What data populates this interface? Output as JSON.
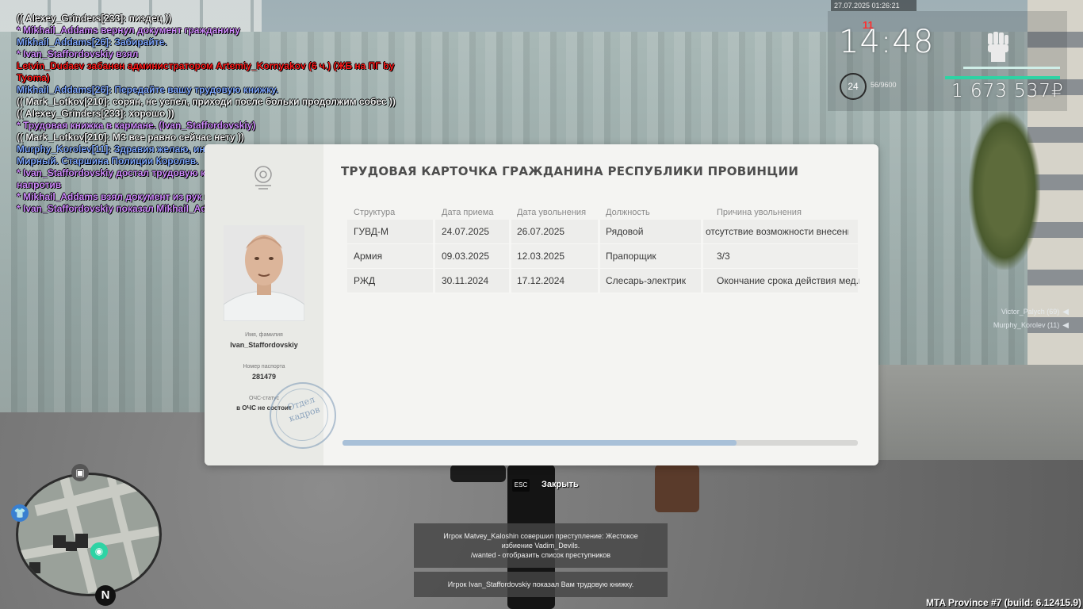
{
  "chat": [
    {
      "text": "(( Alexey_Grinders[233]: пиздец ))",
      "color": "white"
    },
    {
      "text": "* Mikhail_Addams вернул документ гражданину",
      "color": "purple"
    },
    {
      "text": "Mikhail_Addams[26]: Забирайте.",
      "color": "blue"
    },
    {
      "text": "* Ivan_Staffordovskiy взял",
      "color": "purple"
    },
    {
      "text": "Letvin_Dudaev забанен администратором Artemiy_Kornyakov (6 ч.) (ЖБ на ПГ by Tyoma)",
      "color": "red"
    },
    {
      "text": "Mikhail_Addams[26]: Передайте вашу трудовую книжку.",
      "color": "blue"
    },
    {
      "text": "(( Mark_Lotkov[210]: сорян, не успел, приходи после больки продолжим собес ))",
      "color": "white"
    },
    {
      "text": "(( Alexey_Grinders[233]: хорошо ))",
      "color": "white"
    },
    {
      "text": "* Трудовая книжка в кармане. (Ivan_Staffordovskiy)",
      "color": "purple"
    },
    {
      "text": "(( Mark_Lotkov[210]: МЗ все равно сейчас нету ))",
      "color": "white"
    },
    {
      "text": "Murphy_Korolev[11]: Здравия желаю, инспектор ОБ ДПС ГИБДД по городу Мирный. Старшина Полиции Королев.",
      "color": "blue"
    },
    {
      "text": "* Ivan_Staffordovskiy достал трудовую книжку из кармана и передал человеку напротив",
      "color": "purple"
    },
    {
      "text": "* Mikhail_Addams взял документ из рук гражданского, начав его изучать",
      "color": "purple"
    },
    {
      "text": "* Ivan_Staffordovskiy показал Mikhail_Addams трудовую книжку",
      "color": "purple"
    }
  ],
  "hud": {
    "datetime": "27.07.2025 01:26:21",
    "time": "14:48",
    "wanted": "11",
    "level": "24",
    "exp": "56/9600",
    "money": "1 673 537₽",
    "icon": "raised-fist-icon"
  },
  "voice": [
    {
      "name": "Victor_Palych (69)"
    },
    {
      "name": "Murphy_Korolev (11)"
    }
  ],
  "card": {
    "title": "ТРУДОВАЯ КАРТОЧКА ГРАЖДАНИНА РЕСПУБЛИКИ ПРОВИНЦИИ",
    "name_label": "Имя, фамилия",
    "name": "Ivan_Staffordovskiy",
    "passport_label": "Номер паспорта",
    "passport": "281479",
    "och_label": "ОЧС-статус",
    "och": "в ОЧС не состоит",
    "stamp_line1": "Отдел",
    "stamp_line2": "кадров",
    "columns": [
      "Структура",
      "Дата приема",
      "Дата увольнения",
      "Должность",
      "Причина увольнения"
    ],
    "rows": [
      [
        "ГУВД-М",
        "24.07.2025",
        "26.07.2025",
        "Рядовой",
        "отсутствие возможности внесения"
      ],
      [
        "Армия",
        "09.03.2025",
        "12.03.2025",
        "Прапорщик",
        "3/3"
      ],
      [
        "РЖД",
        "30.11.2024",
        "17.12.2024",
        "Слесарь-электрик",
        "Окончание срока действия мед.ка"
      ]
    ],
    "scroll_fraction": 0.765
  },
  "close": {
    "key": "ESC",
    "label": "Закрыть"
  },
  "notifications": [
    {
      "lines": [
        "Игрок Matvey_Kaloshin совершил преступление: Жестокое",
        "избиение Vadim_Devils.",
        "/wanted - отобразить список преступников"
      ]
    },
    {
      "lines": [
        "Игрок Ivan_Staffordovskiy показал Вам трудовую книжку."
      ]
    }
  ],
  "build": "MTA Province #7 (build: 6.12415.9)",
  "minimap": {
    "north": "N"
  },
  "colors": {
    "chat_white": "#f2f2f2",
    "chat_purple": "#d08bff",
    "chat_red": "#ff1a1a",
    "chat_blue": "#7fa8ff",
    "accent_green": "#2ed3a4"
  }
}
